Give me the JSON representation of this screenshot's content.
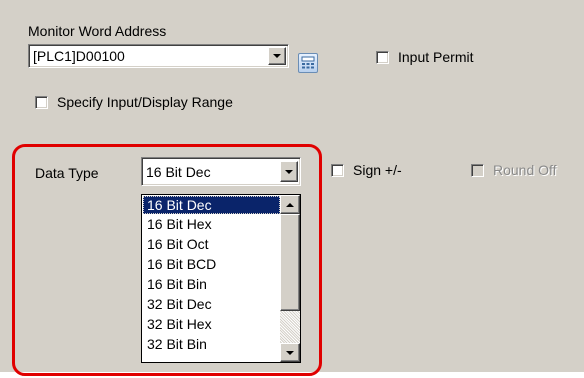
{
  "monitor_word_address": {
    "label": "Monitor Word Address",
    "value": "[PLC1]D00100",
    "input_permit_label": "Input Permit",
    "input_permit_checked": false
  },
  "range": {
    "label": "Specify Input/Display Range",
    "checked": false
  },
  "data_type": {
    "label": "Data Type",
    "selected": "16 Bit Dec",
    "sign_label": "Sign +/-",
    "sign_checked": false,
    "round_off_label": "Round Off",
    "round_off_enabled": false,
    "options": [
      "16 Bit Dec",
      "16 Bit Hex",
      "16 Bit Oct",
      "16 Bit BCD",
      "16 Bit Bin",
      "32 Bit Dec",
      "32 Bit Hex",
      "32 Bit Bin"
    ],
    "highlighted_option": "16 Bit Dec"
  },
  "colors": {
    "dialog_background": "#d4d0c8",
    "highlight_frame": "#e00000",
    "selection": "#0a246a"
  }
}
